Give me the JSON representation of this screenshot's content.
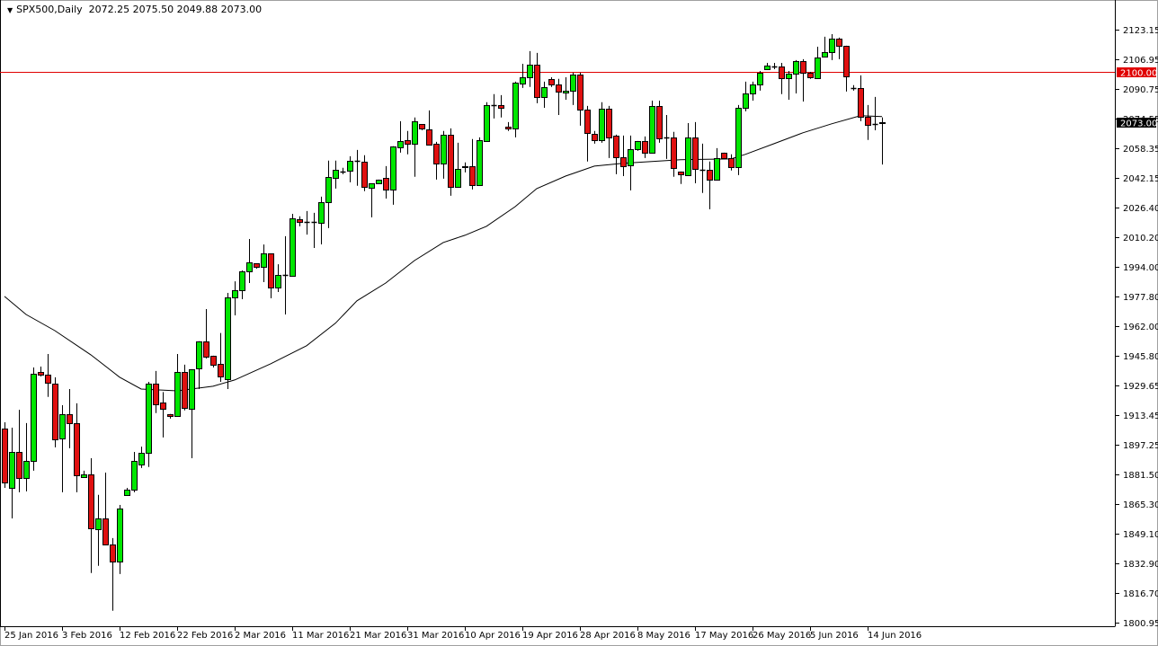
{
  "header": {
    "symbol": "SPX500,Daily",
    "ohlc": "2072.25 2075.50 2049.88 2073.00"
  },
  "colors": {
    "bull": "#00e600",
    "bear": "#e01010",
    "outline": "#000000",
    "level_line": "#e00000",
    "ma_line": "#000000"
  },
  "chart_data": {
    "type": "candlestick",
    "title": "SPX500,Daily",
    "ylim": [
      1800.95,
      2123.15
    ],
    "y_ticks": [
      "2123.15",
      "2106.95",
      "2090.75",
      "2074.55",
      "2058.35",
      "2042.15",
      "2026.40",
      "2010.20",
      "1994.00",
      "1977.80",
      "1962.00",
      "1945.80",
      "1929.65",
      "1913.45",
      "1897.25",
      "1881.50",
      "1865.30",
      "1849.10",
      "1832.90",
      "1816.70",
      "1800.95"
    ],
    "x_labels": [
      "25 Jan 2016",
      "3 Feb 2016",
      "12 Feb 2016",
      "22 Feb 2016",
      "2 Mar 2016",
      "11 Mar 2016",
      "21 Mar 2016",
      "31 Mar 2016",
      "10 Apr 2016",
      "19 Apr 2016",
      "28 Apr 2016",
      "8 May 2016",
      "17 May 2016",
      "26 May 2016",
      "5 Jun 2016",
      "14 Jun 2016"
    ],
    "x_label_every": 8,
    "horizontal_level": {
      "value": 2100.0,
      "label": "2100.00"
    },
    "current_price": {
      "value": 2073.0,
      "label": "2073.00"
    },
    "ohlc_fields": [
      "open",
      "high",
      "low",
      "close"
    ],
    "candles": [
      [
        1906.4,
        1909.8,
        1874.2,
        1877.1
      ],
      [
        1874.2,
        1906.9,
        1857.6,
        1893.7
      ],
      [
        1893.7,
        1916.6,
        1871.8,
        1879.6
      ],
      [
        1879.6,
        1909.4,
        1872.3,
        1888.9
      ],
      [
        1888.9,
        1939.6,
        1883.5,
        1936.2
      ],
      [
        1937.2,
        1940.1,
        1934.7,
        1935.7
      ],
      [
        1935.7,
        1946.9,
        1923.6,
        1931.3
      ],
      [
        1930.8,
        1934.2,
        1896.2,
        1900.6
      ],
      [
        1901.1,
        1919.1,
        1871.8,
        1914.3
      ],
      [
        1914.3,
        1927.9,
        1895.7,
        1909.4
      ],
      [
        1909.4,
        1920.1,
        1871.8,
        1881.1
      ],
      [
        1880.1,
        1883.5,
        1879.6,
        1881.6
      ],
      [
        1881.6,
        1890.3,
        1827.9,
        1852.2
      ],
      [
        1851.8,
        1870.4,
        1831.8,
        1857.6
      ],
      [
        1857.6,
        1882.5,
        1843.0,
        1843.5
      ],
      [
        1843.5,
        1846.9,
        1807.4,
        1834.2
      ],
      [
        1834.2,
        1864.9,
        1827.4,
        1863.0
      ],
      [
        1870.3,
        1874.2,
        1869.8,
        1873.3
      ],
      [
        1873.3,
        1893.7,
        1871.8,
        1888.9
      ],
      [
        1886.9,
        1896.6,
        1885.0,
        1893.2
      ],
      [
        1893.2,
        1931.8,
        1885.5,
        1930.8
      ],
      [
        1930.8,
        1937.7,
        1914.8,
        1919.6
      ],
      [
        1920.6,
        1926.2,
        1901.6,
        1917.2
      ],
      [
        1914.3,
        1914.3,
        1911.8,
        1913.3
      ],
      [
        1913.3,
        1946.9,
        1913.3,
        1937.2
      ],
      [
        1937.2,
        1941.1,
        1916.3,
        1917.7
      ],
      [
        1917.2,
        1938.7,
        1890.3,
        1938.7
      ],
      [
        1939.2,
        1953.9,
        1927.9,
        1953.9
      ],
      [
        1953.9,
        1971.3,
        1944.5,
        1945.6
      ],
      [
        1946.0,
        1946.0,
        1939.6,
        1941.1
      ],
      [
        1941.6,
        1958.3,
        1931.8,
        1934.7
      ],
      [
        1933.2,
        1980.1,
        1927.9,
        1977.6
      ],
      [
        1977.6,
        1986.4,
        1967.9,
        1981.6
      ],
      [
        1981.6,
        1992.3,
        1976.7,
        1991.8
      ],
      [
        1991.8,
        2009.4,
        1985.5,
        1996.7
      ],
      [
        1996.2,
        1996.2,
        1993.3,
        1994.2
      ],
      [
        1994.2,
        2006.4,
        1986.0,
        2001.6
      ],
      [
        2001.6,
        2001.6,
        1977.2,
        1983.0
      ],
      [
        1983.0,
        1995.7,
        1980.6,
        1989.9
      ],
      [
        1989.9,
        2010.9,
        1968.4,
        1989.9
      ],
      [
        1989.4,
        2023.1,
        1988.9,
        2020.7
      ],
      [
        2020.2,
        2021.7,
        2016.3,
        2018.7
      ],
      [
        2018.7,
        2024.6,
        2011.8,
        2018.8
      ],
      [
        2018.7,
        2023.6,
        2004.5,
        2018.5
      ],
      [
        2018.3,
        2032.4,
        2006.5,
        2029.5
      ],
      [
        2029.5,
        2052.0,
        2015.3,
        2043.2
      ],
      [
        2042.7,
        2052.0,
        2036.8,
        2047.1
      ],
      [
        2046.1,
        2048.1,
        2044.6,
        2046.2
      ],
      [
        2046.6,
        2054.4,
        2040.2,
        2052.0
      ],
      [
        2052.0,
        2057.8,
        2038.3,
        2052.1
      ],
      [
        2051.5,
        2054.9,
        2035.4,
        2037.8
      ],
      [
        2037.3,
        2039.7,
        2021.2,
        2039.7
      ],
      [
        2039.7,
        2041.7,
        2039.3,
        2041.7
      ],
      [
        2042.7,
        2049.0,
        2031.4,
        2036.3
      ],
      [
        2036.3,
        2059.8,
        2028.0,
        2059.8
      ],
      [
        2059.3,
        2073.4,
        2056.3,
        2062.7
      ],
      [
        2063.2,
        2068.1,
        2055.4,
        2061.2
      ],
      [
        2061.2,
        2075.4,
        2043.2,
        2073.4
      ],
      [
        2071.9,
        2071.9,
        2068.5,
        2069.5
      ],
      [
        2069.0,
        2079.3,
        2060.2,
        2060.7
      ],
      [
        2061.2,
        2062.2,
        2041.7,
        2050.5
      ],
      [
        2050.5,
        2068.1,
        2042.2,
        2066.1
      ],
      [
        2066.1,
        2069.5,
        2032.9,
        2037.8
      ],
      [
        2037.8,
        2061.7,
        2037.8,
        2047.6
      ],
      [
        2049.0,
        2051.0,
        2045.6,
        2048.5
      ],
      [
        2049.0,
        2063.7,
        2036.3,
        2038.8
      ],
      [
        2038.8,
        2064.6,
        2038.8,
        2063.2
      ],
      [
        2062.7,
        2083.7,
        2062.2,
        2082.2
      ],
      [
        2082.2,
        2088.1,
        2074.9,
        2082.3
      ],
      [
        2082.2,
        2087.6,
        2075.4,
        2080.7
      ],
      [
        2070.5,
        2072.9,
        2068.1,
        2069.5
      ],
      [
        2069.5,
        2094.9,
        2064.6,
        2094.4
      ],
      [
        2093.9,
        2104.6,
        2091.5,
        2097.3
      ],
      [
        2097.3,
        2111.5,
        2092.0,
        2104.1
      ],
      [
        2104.1,
        2110.5,
        2083.2,
        2086.6
      ],
      [
        2086.6,
        2094.9,
        2080.7,
        2092.0
      ],
      [
        2096.4,
        2097.3,
        2092.0,
        2093.4
      ],
      [
        2093.4,
        2096.4,
        2076.8,
        2089.5
      ],
      [
        2089.0,
        2097.3,
        2085.1,
        2090.0
      ],
      [
        2090.0,
        2099.8,
        2082.2,
        2098.8
      ],
      [
        2098.8,
        2099.8,
        2071.0,
        2079.8
      ],
      [
        2079.8,
        2081.7,
        2051.5,
        2067.1
      ],
      [
        2066.6,
        2068.1,
        2061.2,
        2063.2
      ],
      [
        2063.2,
        2083.7,
        2061.7,
        2080.2
      ],
      [
        2080.2,
        2081.7,
        2053.4,
        2064.6
      ],
      [
        2065.6,
        2066.1,
        2044.6,
        2053.9
      ],
      [
        2053.9,
        2065.6,
        2043.6,
        2049.0
      ],
      [
        2049.5,
        2065.6,
        2035.8,
        2058.3
      ],
      [
        2058.3,
        2062.7,
        2057.3,
        2062.7
      ],
      [
        2062.7,
        2065.1,
        2053.4,
        2056.3
      ],
      [
        2056.3,
        2084.6,
        2056.3,
        2081.7
      ],
      [
        2081.7,
        2084.6,
        2061.7,
        2064.1
      ],
      [
        2064.6,
        2076.8,
        2052.9,
        2064.7
      ],
      [
        2064.6,
        2067.6,
        2043.2,
        2048.1
      ],
      [
        2046.1,
        2046.1,
        2039.3,
        2044.6
      ],
      [
        2044.1,
        2072.4,
        2043.6,
        2064.6
      ],
      [
        2064.6,
        2072.9,
        2039.7,
        2047.6
      ],
      [
        2047.1,
        2061.2,
        2034.4,
        2047.2
      ],
      [
        2047.1,
        2051.5,
        2025.6,
        2041.7
      ],
      [
        2041.7,
        2058.8,
        2041.7,
        2053.4
      ],
      [
        2056.3,
        2056.3,
        2052.9,
        2053.4
      ],
      [
        2053.4,
        2055.4,
        2046.6,
        2048.5
      ],
      [
        2048.5,
        2082.2,
        2044.1,
        2080.7
      ],
      [
        2080.7,
        2094.9,
        2078.8,
        2088.5
      ],
      [
        2088.5,
        2094.9,
        2084.6,
        2093.4
      ],
      [
        2093.4,
        2100.7,
        2090.0,
        2099.8
      ],
      [
        2101.7,
        2105.1,
        2101.7,
        2103.7
      ],
      [
        2103.2,
        2105.1,
        2101.7,
        2103.3
      ],
      [
        2103.2,
        2105.1,
        2088.1,
        2096.8
      ],
      [
        2096.8,
        2100.7,
        2085.1,
        2099.3
      ],
      [
        2099.3,
        2106.6,
        2088.5,
        2106.1
      ],
      [
        2106.1,
        2107.1,
        2084.1,
        2099.8
      ],
      [
        2099.8,
        2100.2,
        2096.4,
        2097.3
      ],
      [
        2096.8,
        2113.9,
        2096.4,
        2108.1
      ],
      [
        2108.5,
        2119.3,
        2108.5,
        2111.0
      ],
      [
        2111.0,
        2120.7,
        2106.6,
        2118.3
      ],
      [
        2118.3,
        2118.8,
        2107.1,
        2114.4
      ],
      [
        2114.4,
        2114.4,
        2089.5,
        2097.8
      ],
      [
        2091.5,
        2093.0,
        2090.0,
        2091.6
      ],
      [
        2091.5,
        2098.3,
        2073.4,
        2075.9
      ],
      [
        2075.9,
        2082.2,
        2063.2,
        2071.5
      ],
      [
        2071.9,
        2086.6,
        2068.5,
        2072.0
      ],
      [
        2072.25,
        2075.5,
        2049.88,
        2073.0
      ]
    ],
    "moving_average": {
      "index": [
        0,
        3,
        7,
        12,
        16,
        19,
        24,
        29,
        32,
        37,
        42,
        46,
        49,
        53,
        57,
        61,
        64,
        67,
        71,
        74,
        78,
        82,
        86,
        90,
        94,
        101,
        103,
        107,
        111,
        115,
        119,
        122
      ],
      "values": [
        1978.2,
        1968.4,
        1959.6,
        1946.5,
        1934.3,
        1927.9,
        1926.9,
        1929.4,
        1932.8,
        1941.6,
        1951.4,
        1963.6,
        1975.8,
        1985.5,
        1997.7,
        2007.5,
        2011.4,
        2016.3,
        2027.0,
        2036.8,
        2043.6,
        2049.0,
        2050.5,
        2051.5,
        2052.5,
        2052.9,
        2055.4,
        2061.2,
        2067.1,
        2072.0,
        2076.4,
        2075.9
      ]
    }
  }
}
